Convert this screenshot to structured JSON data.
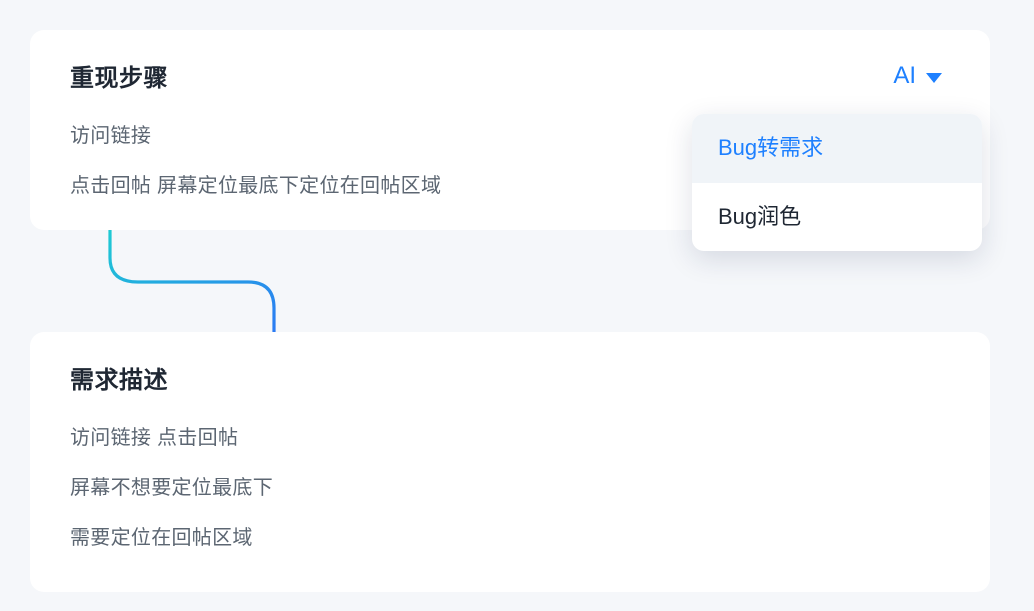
{
  "cards": {
    "top": {
      "title": "重现步骤",
      "lines": [
        "访问链接",
        "点击回帖 屏幕定位最底下定位在回帖区域"
      ]
    },
    "bottom": {
      "title": "需求描述",
      "lines": [
        "访问链接 点击回帖",
        "屏幕不想要定位最底下",
        "需要定位在回帖区域"
      ]
    }
  },
  "ai": {
    "label": "AI",
    "dropdown": [
      {
        "label": "Bug转需求",
        "active": true
      },
      {
        "label": "Bug润色",
        "active": false
      }
    ]
  }
}
